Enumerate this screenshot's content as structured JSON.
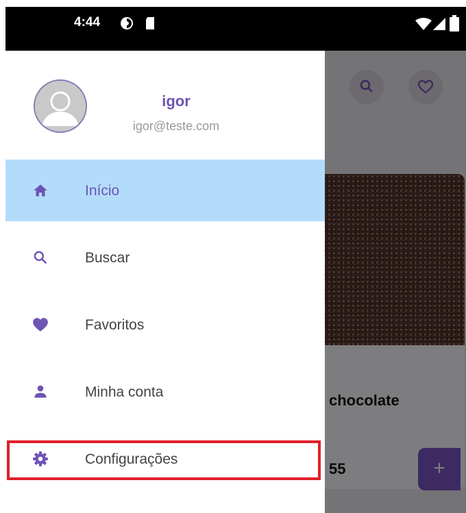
{
  "status_bar": {
    "time": "4:44",
    "left_icons": [
      "sync-icon",
      "sd-card-icon"
    ],
    "right_icons": [
      "wifi-icon",
      "signal-icon",
      "battery-icon"
    ]
  },
  "background": {
    "header_icons": [
      "search-icon",
      "heart-outline-icon"
    ],
    "product_title": "chocolate",
    "product_price": "55",
    "add_label": "+"
  },
  "drawer": {
    "user": {
      "name": "igor",
      "email": "igor@teste.com"
    },
    "items": [
      {
        "label": "Início",
        "icon": "home-icon",
        "active": true
      },
      {
        "label": "Buscar",
        "icon": "search-icon",
        "active": false
      },
      {
        "label": "Favoritos",
        "icon": "heart-icon",
        "active": false
      },
      {
        "label": "Minha conta",
        "icon": "person-icon",
        "active": false
      },
      {
        "label": "Configurações",
        "icon": "gear-icon",
        "active": false
      }
    ]
  },
  "colors": {
    "accent": "#6e54b3",
    "active_bg": "#b3dcfb",
    "highlight_border": "#e0202a",
    "status_bar": "#000000"
  }
}
